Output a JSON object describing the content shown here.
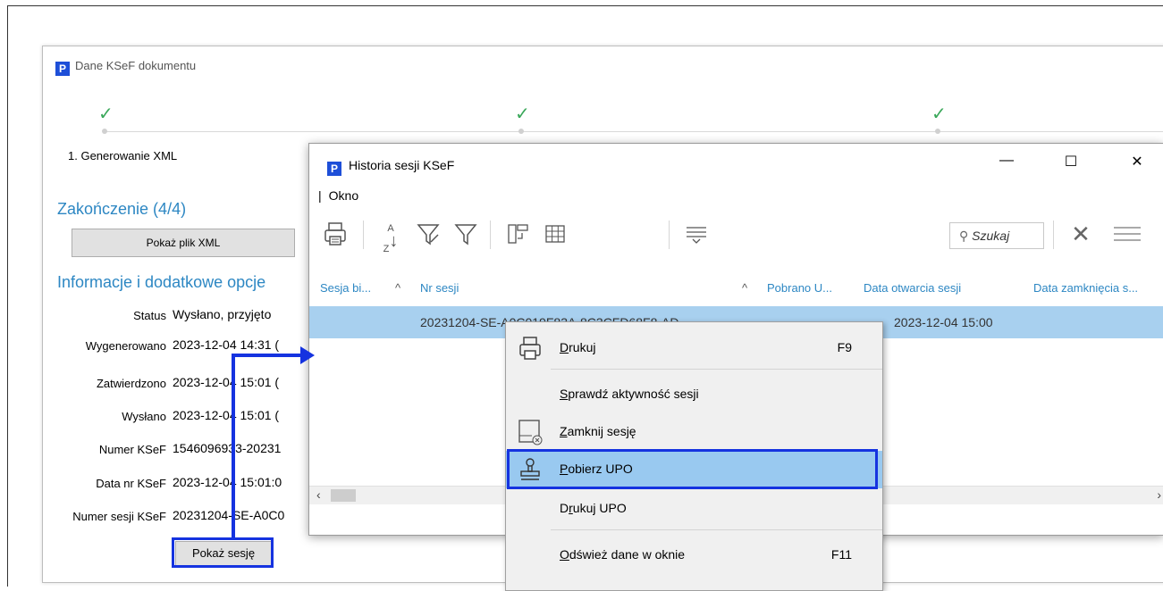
{
  "back_window": {
    "title": "Dane KSeF dokumentu",
    "step1": "1. Generowanie XML",
    "section_end": "Zakończenie (4/4)",
    "show_xml": "Pokaż plik XML",
    "section_info": "Informacje i dodatkowe opcje",
    "fields": [
      {
        "label": "Status",
        "value": "Wysłano, przyjęto"
      },
      {
        "label": "Wygenerowano",
        "value": "2023-12-04 14:31 ("
      },
      {
        "label": "Zatwierdzono",
        "value": "2023-12-04 15:01 ("
      },
      {
        "label": "Wysłano",
        "value": "2023-12-04 15:01 ("
      },
      {
        "label": "Numer KSeF",
        "value": "1546096933-20231"
      },
      {
        "label": "Data nr KSeF",
        "value": "2023-12-04 15:01:0"
      },
      {
        "label": "Numer sesji KSeF",
        "value": "20231204-SE-A0C0"
      }
    ],
    "show_session": "Pokaż sesję"
  },
  "session_window": {
    "title": "Historia sesji KSeF",
    "menu": "Okno",
    "minimize": "—",
    "maximize": "☐",
    "close": "✕",
    "search_placeholder": "Szukaj",
    "columns": [
      "Sesja bi...",
      "Nr sesji",
      "Pobrano U...",
      "Data otwarcia sesji",
      "Data zamknięcia s..."
    ],
    "rows": [
      {
        "nr_sesji": "20231204-SE-A0C019F83A-8C3CFD68F8-AD",
        "data_otwarcia": "2023-12-04 15:00"
      }
    ]
  },
  "context_menu": {
    "items": [
      {
        "label": "Drukuj",
        "u": "D",
        "shortcut": "F9",
        "icon": "printer-icon"
      },
      {
        "label": "Sprawdź aktywność sesji",
        "u": "S",
        "shortcut": ""
      },
      {
        "label": "Zamknij sesję",
        "u": "Z",
        "shortcut": "",
        "icon": "close-session-icon"
      },
      {
        "label": "Pobierz UPO",
        "u": "P",
        "shortcut": "",
        "icon": "stamp-icon",
        "highlighted": true
      },
      {
        "label": "Drukuj UPO",
        "u": "r",
        "shortcut": ""
      },
      {
        "label": "Odśwież dane w oknie",
        "u": "O",
        "shortcut": "F11"
      }
    ]
  },
  "colors": {
    "accent": "#2d87c3",
    "highlight": "#99c9f0",
    "annotation": "#1533e0",
    "check": "#3aa85a"
  }
}
